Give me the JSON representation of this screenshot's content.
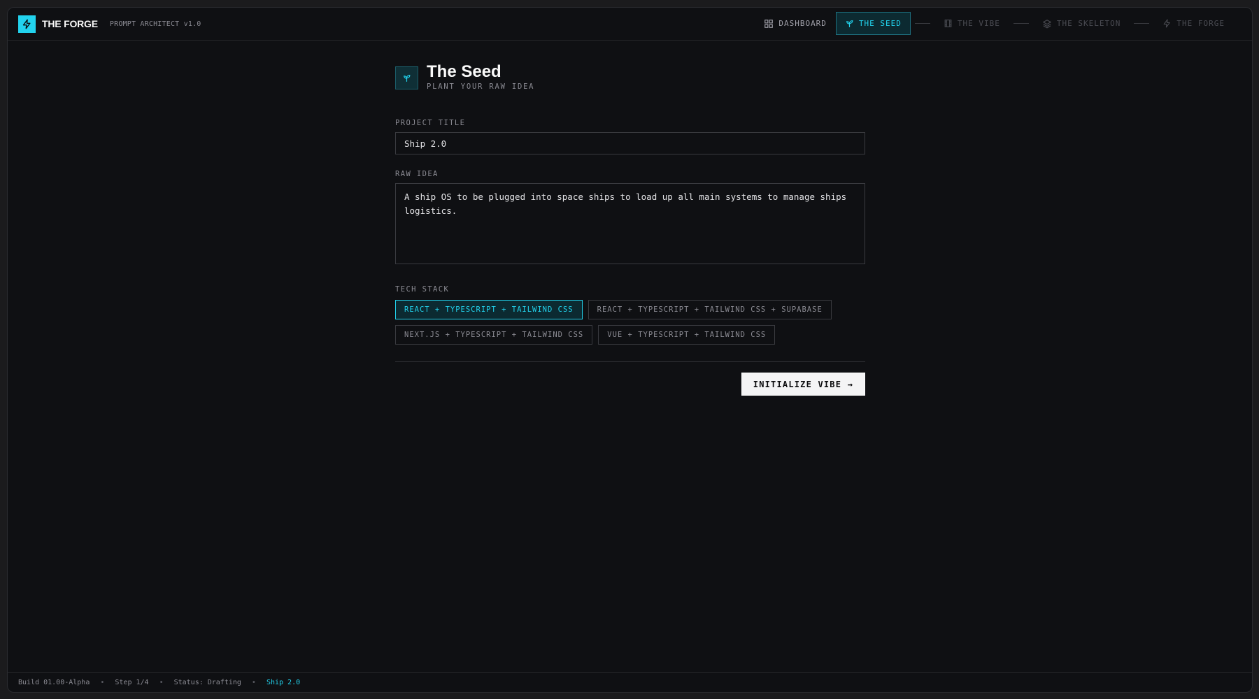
{
  "app": {
    "brand_name": "THE FORGE",
    "brand_sub": "PROMPT ARCHITECT v1.0",
    "accent_color": "#22d3ee"
  },
  "nav": {
    "dashboard": "DASHBOARD",
    "steps": [
      {
        "label": "THE SEED",
        "icon": "sprout-icon",
        "state": "active"
      },
      {
        "label": "THE VIBE",
        "icon": "film-icon",
        "state": "locked"
      },
      {
        "label": "THE SKELETON",
        "icon": "layers-icon",
        "state": "locked"
      },
      {
        "label": "THE FORGE",
        "icon": "bolt-icon",
        "state": "locked"
      }
    ]
  },
  "page": {
    "title": "The Seed",
    "subtitle": "PLANT YOUR RAW IDEA"
  },
  "form": {
    "project_title_label": "PROJECT TITLE",
    "project_title_value": "Ship 2.0",
    "raw_idea_label": "RAW IDEA",
    "raw_idea_value": "A ship OS to be plugged into space ships to load up all main systems to manage ships logistics.",
    "tech_stack_label": "TECH STACK",
    "tech_stack_options": [
      {
        "label": "REACT + TYPESCRIPT + TAILWIND CSS",
        "selected": true
      },
      {
        "label": "REACT + TYPESCRIPT + TAILWIND CSS + SUPABASE",
        "selected": false
      },
      {
        "label": "NEXT.JS + TYPESCRIPT + TAILWIND CSS",
        "selected": false
      },
      {
        "label": "VUE + TYPESCRIPT + TAILWIND CSS",
        "selected": false
      }
    ],
    "submit_label": "INITIALIZE VIBE →"
  },
  "status": {
    "build": "Build 01.00-Alpha",
    "step": "Step 1/4",
    "state": "Status: Drafting",
    "project": "Ship 2.0",
    "separator": "•"
  }
}
